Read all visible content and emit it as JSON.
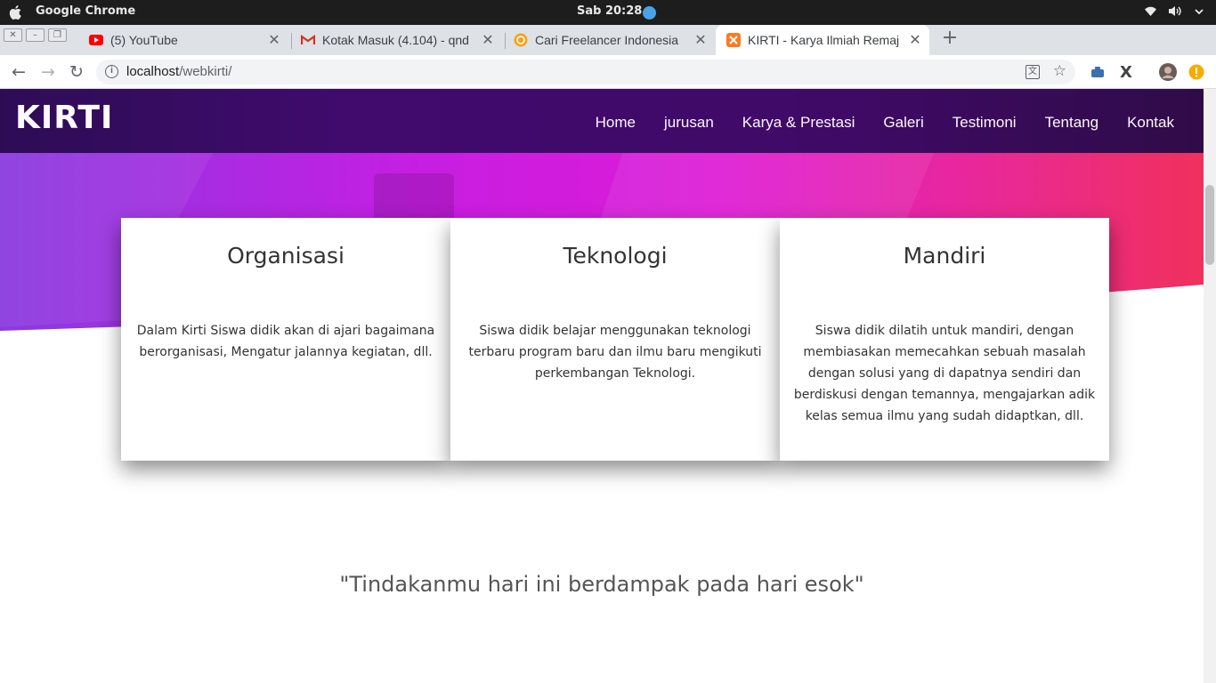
{
  "os": {
    "app_name": "Google Chrome",
    "clock": "Sab 20:28"
  },
  "tabs": [
    {
      "title": "(5) YouTube",
      "icon": "youtube-icon"
    },
    {
      "title": "Kotak Masuk (4.104) - qnd",
      "icon": "gmail-icon"
    },
    {
      "title": "Cari Freelancer Indonesia",
      "icon": "freelancer-icon"
    },
    {
      "title": "KIRTI - Karya Ilmiah Remaj",
      "icon": "xampp-icon"
    }
  ],
  "address": {
    "host": "localhost",
    "path": "/webkirti/"
  },
  "site": {
    "brand": "KIRTI",
    "menu": [
      "Home",
      "jurusan",
      "Karya & Prestasi",
      "Galeri",
      "Testimoni",
      "Tentang",
      "Kontak"
    ]
  },
  "cards": [
    {
      "title": "Organisasi",
      "text": "Dalam Kirti Siswa didik akan di ajari bagaimana berorganisasi, Mengatur jalannya kegiatan, dll."
    },
    {
      "title": "Teknologi",
      "text": "Siswa didik belajar menggunakan teknologi terbaru program baru dan ilmu baru mengikuti perkembangan Teknologi."
    },
    {
      "title": "Mandiri",
      "text": "Siswa didik dilatih untuk mandiri, dengan membiasakan memecahkan sebuah masalah dengan solusi yang di dapatnya sendiri dan berdiskusi dengan temannya, mengajarkan adik kelas semua ilmu yang sudah didaptkan, dll."
    }
  ],
  "quote": "\"Tindakanmu hari ini berdampak pada hari esok\"",
  "colors": {
    "nav_bg": "#3d0a6a",
    "hero_gradient": [
      "#8b3bd9",
      "#d61de0",
      "#ea2a7c"
    ],
    "tab_strip": "#dee1e6"
  }
}
